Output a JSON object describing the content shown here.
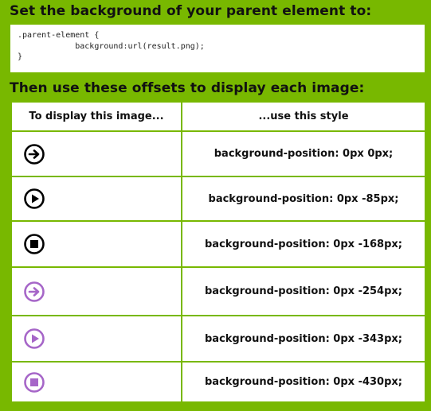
{
  "headings": {
    "background_instruction": "Set the background of your parent element to:",
    "offsets_instruction": "Then use these offsets to display each image:"
  },
  "code": {
    "lines": [
      ".parent-element {",
      "            background:url(result.png);",
      "}"
    ]
  },
  "table": {
    "headers": [
      "To display this image...",
      "...use this style"
    ],
    "rows": [
      {
        "icon": "arrow-right-circle-icon",
        "color": "#000000",
        "style": "background-position: 0px 0px;"
      },
      {
        "icon": "play-circle-icon",
        "color": "#000000",
        "style": "background-position: 0px -85px;"
      },
      {
        "icon": "stop-circle-icon",
        "color": "#000000",
        "style": "background-position: 0px -168px;"
      },
      {
        "icon": "arrow-right-circle-icon",
        "color": "#a666c8",
        "style": "background-position: 0px -254px;"
      },
      {
        "icon": "play-circle-icon",
        "color": "#a666c8",
        "style": "background-position: 0px -343px;"
      },
      {
        "icon": "stop-circle-icon",
        "color": "#a666c8",
        "style": "background-position: 0px -430px;"
      }
    ]
  },
  "colors": {
    "page_background": "#78b800",
    "icon_black": "#000000",
    "icon_purple": "#a666c8"
  }
}
